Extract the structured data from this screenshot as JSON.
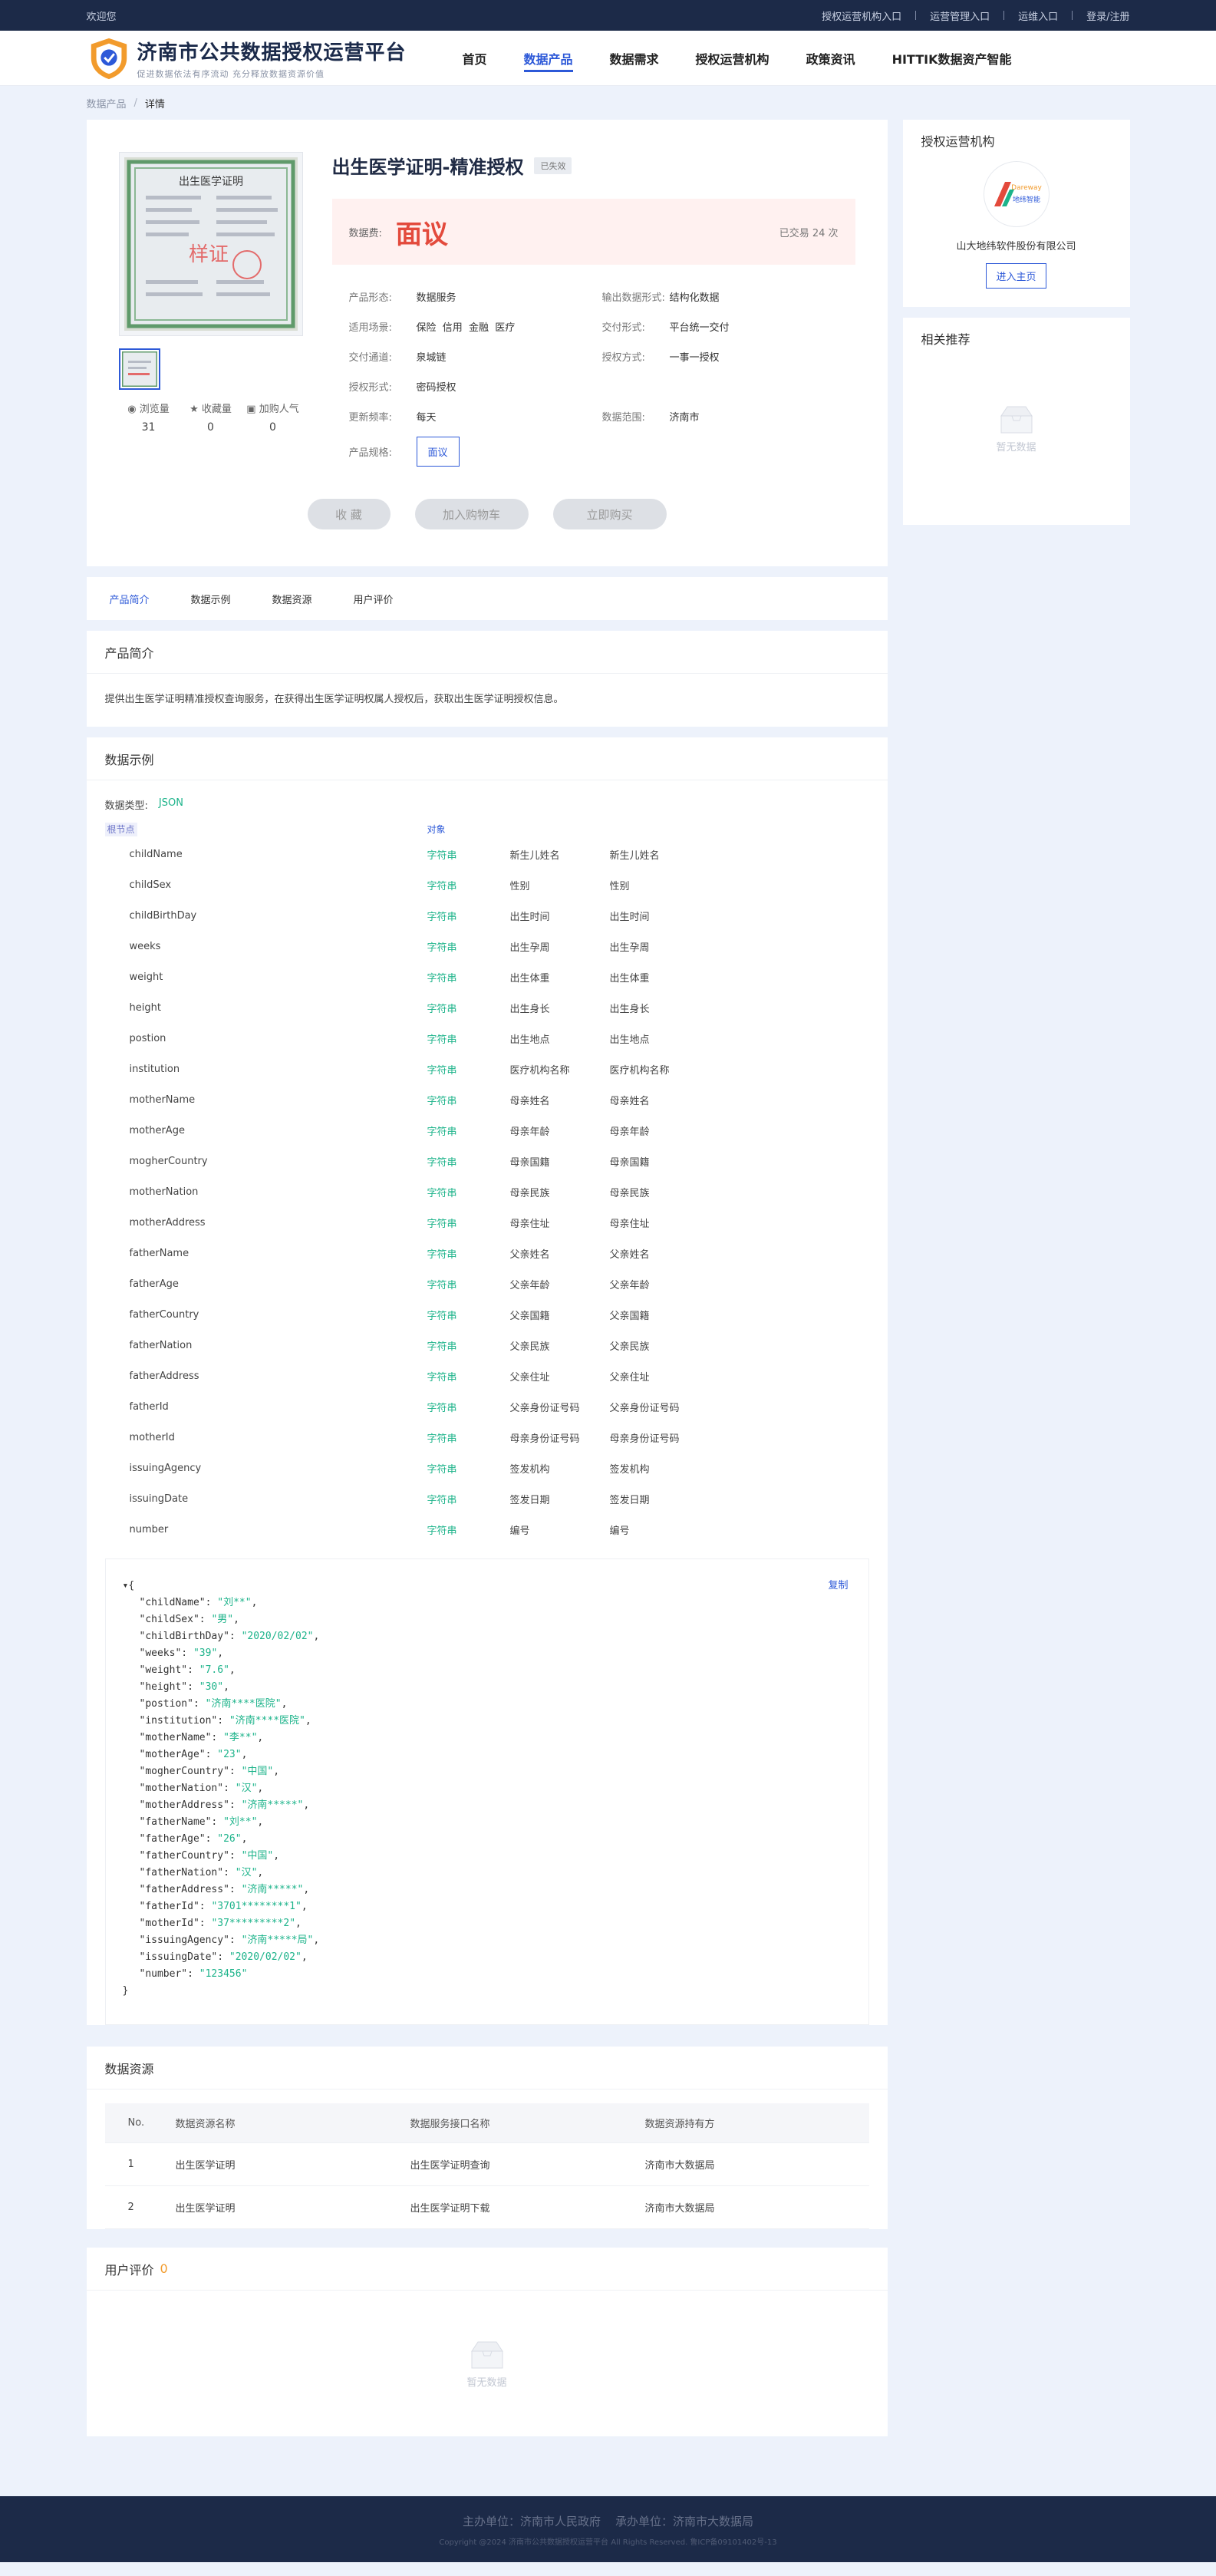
{
  "topbar": {
    "welcome": "欢迎您",
    "links": [
      "授权运营机构入口",
      "运营管理入口",
      "运维入口",
      "登录/注册"
    ]
  },
  "logo": {
    "title": "济南市公共数据授权运营平台",
    "slogan": "促进数据依法有序流动 充分释放数据资源价值"
  },
  "nav": {
    "items": [
      {
        "label": "首页",
        "active": false
      },
      {
        "label": "数据产品",
        "active": true
      },
      {
        "label": "数据需求",
        "active": false
      },
      {
        "label": "授权运营机构",
        "active": false
      },
      {
        "label": "政策资讯",
        "active": false
      },
      {
        "label": "HITTIK数据资产智能",
        "active": false
      }
    ]
  },
  "breadcrumb": {
    "root": "数据产品",
    "sep": "/",
    "current": "详情"
  },
  "product": {
    "image_text": "出生医学证明",
    "watermark": "样证",
    "title": "出生医学证明-精准授权",
    "badge": "已失效",
    "price_label": "数据费:",
    "price": "面议",
    "traded": "已交易 24 次",
    "stats": [
      {
        "icon": "eye-icon",
        "label": "浏览量",
        "value": "31"
      },
      {
        "icon": "star-icon",
        "label": "收藏量",
        "value": "0"
      },
      {
        "icon": "cart-icon",
        "label": "加购人气",
        "value": "0"
      }
    ],
    "attrs": [
      {
        "k": "产品形态:",
        "v": "数据服务"
      },
      {
        "k": "输出数据形式:",
        "v": "结构化数据"
      },
      {
        "k": "适用场景:",
        "v": "保险  信用  金融  医疗"
      },
      {
        "k": "交付形式:",
        "v": "平台统一交付"
      },
      {
        "k": "交付通道:",
        "v": "泉城链"
      },
      {
        "k": "授权方式:",
        "v": "一事一授权"
      },
      {
        "k": "授权形式:",
        "v": "密码授权"
      },
      {
        "k": "",
        "v": ""
      },
      {
        "k": "更新频率:",
        "v": "每天"
      },
      {
        "k": "数据范围:",
        "v": "济南市"
      }
    ],
    "spec_label": "产品规格:",
    "spec_value": "面议",
    "actions": [
      "收 藏",
      "加入购物车",
      "立即购买"
    ]
  },
  "tabs": [
    "产品简介",
    "数据示例",
    "数据资源",
    "用户评价"
  ],
  "intro": {
    "title": "产品简介",
    "text": "提供出生医学证明精准授权查询服务，在获得出生医学证明权属人授权后，获取出生医学证明授权信息。"
  },
  "sample": {
    "title": "数据示例",
    "type_label": "数据类型:",
    "type_value": "JSON",
    "root_label": "根节点",
    "root_type": "对象",
    "fields": [
      [
        "childName",
        "字符串",
        "新生儿姓名",
        "新生儿姓名"
      ],
      [
        "childSex",
        "字符串",
        "性别",
        "性别"
      ],
      [
        "childBirthDay",
        "字符串",
        "出生时间",
        "出生时间"
      ],
      [
        "weeks",
        "字符串",
        "出生孕周",
        "出生孕周"
      ],
      [
        "weight",
        "字符串",
        "出生体重",
        "出生体重"
      ],
      [
        "height",
        "字符串",
        "出生身长",
        "出生身长"
      ],
      [
        "postion",
        "字符串",
        "出生地点",
        "出生地点"
      ],
      [
        "institution",
        "字符串",
        "医疗机构名称",
        "医疗机构名称"
      ],
      [
        "motherName",
        "字符串",
        "母亲姓名",
        "母亲姓名"
      ],
      [
        "motherAge",
        "字符串",
        "母亲年龄",
        "母亲年龄"
      ],
      [
        "mogherCountry",
        "字符串",
        "母亲国籍",
        "母亲国籍"
      ],
      [
        "motherNation",
        "字符串",
        "母亲民族",
        "母亲民族"
      ],
      [
        "motherAddress",
        "字符串",
        "母亲住址",
        "母亲住址"
      ],
      [
        "fatherName",
        "字符串",
        "父亲姓名",
        "父亲姓名"
      ],
      [
        "fatherAge",
        "字符串",
        "父亲年龄",
        "父亲年龄"
      ],
      [
        "fatherCountry",
        "字符串",
        "父亲国籍",
        "父亲国籍"
      ],
      [
        "fatherNation",
        "字符串",
        "父亲民族",
        "父亲民族"
      ],
      [
        "fatherAddress",
        "字符串",
        "父亲住址",
        "父亲住址"
      ],
      [
        "fatherId",
        "字符串",
        "父亲身份证号码",
        "父亲身份证号码"
      ],
      [
        "motherId",
        "字符串",
        "母亲身份证号码",
        "母亲身份证号码"
      ],
      [
        "issuingAgency",
        "字符串",
        "签发机构",
        "签发机构"
      ],
      [
        "issuingDate",
        "字符串",
        "签发日期",
        "签发日期"
      ],
      [
        "number",
        "字符串",
        "编号",
        "编号"
      ]
    ],
    "copy_label": "复制",
    "json": [
      [
        "childName",
        "刘**"
      ],
      [
        "childSex",
        "男"
      ],
      [
        "childBirthDay",
        "2020/02/02"
      ],
      [
        "weeks",
        "39"
      ],
      [
        "weight",
        "7.6"
      ],
      [
        "height",
        "30"
      ],
      [
        "postion",
        "济南****医院"
      ],
      [
        "institution",
        "济南****医院"
      ],
      [
        "motherName",
        "李**"
      ],
      [
        "motherAge",
        "23"
      ],
      [
        "mogherCountry",
        "中国"
      ],
      [
        "motherNation",
        "汉"
      ],
      [
        "motherAddress",
        "济南*****"
      ],
      [
        "fatherName",
        "刘**"
      ],
      [
        "fatherAge",
        "26"
      ],
      [
        "fatherCountry",
        "中国"
      ],
      [
        "fatherNation",
        "汉"
      ],
      [
        "fatherAddress",
        "济南*****"
      ],
      [
        "fatherId",
        "3701********1"
      ],
      [
        "motherId",
        "37*********2"
      ],
      [
        "issuingAgency",
        "济南*****局"
      ],
      [
        "issuingDate",
        "2020/02/02"
      ],
      [
        "number",
        "123456"
      ]
    ]
  },
  "resources": {
    "title": "数据资源",
    "headers": [
      "No.",
      "数据资源名称",
      "数据服务接口名称",
      "数据资源持有方"
    ],
    "rows": [
      [
        "1",
        "出生医学证明",
        "出生医学证明查询",
        "济南市大数据局"
      ],
      [
        "2",
        "出生医学证明",
        "出生医学证明下载",
        "济南市大数据局"
      ]
    ]
  },
  "reviews": {
    "title": "用户评价",
    "count": "0",
    "empty": "暂无数据"
  },
  "side": {
    "org_title": "授权运营机构",
    "logo_text": "Dareway",
    "logo_sub": "地纬智能",
    "org_name": "山大地纬软件股份有限公司",
    "org_button": "进入主页",
    "rec_title": "相关推荐",
    "rec_empty": "暂无数据"
  },
  "footer": {
    "line1": "主办单位：济南市人民政府    承办单位：济南市大数据局",
    "line2": "Copyright @2024 济南市公共数据授权运营平台 All Rights Reserved. 鲁ICP备09101402号-13"
  },
  "colors": {
    "primary": "#2d59d8",
    "topbar": "#1c2a48",
    "price": "#e34a3c",
    "string_type": "#1cb38a"
  }
}
